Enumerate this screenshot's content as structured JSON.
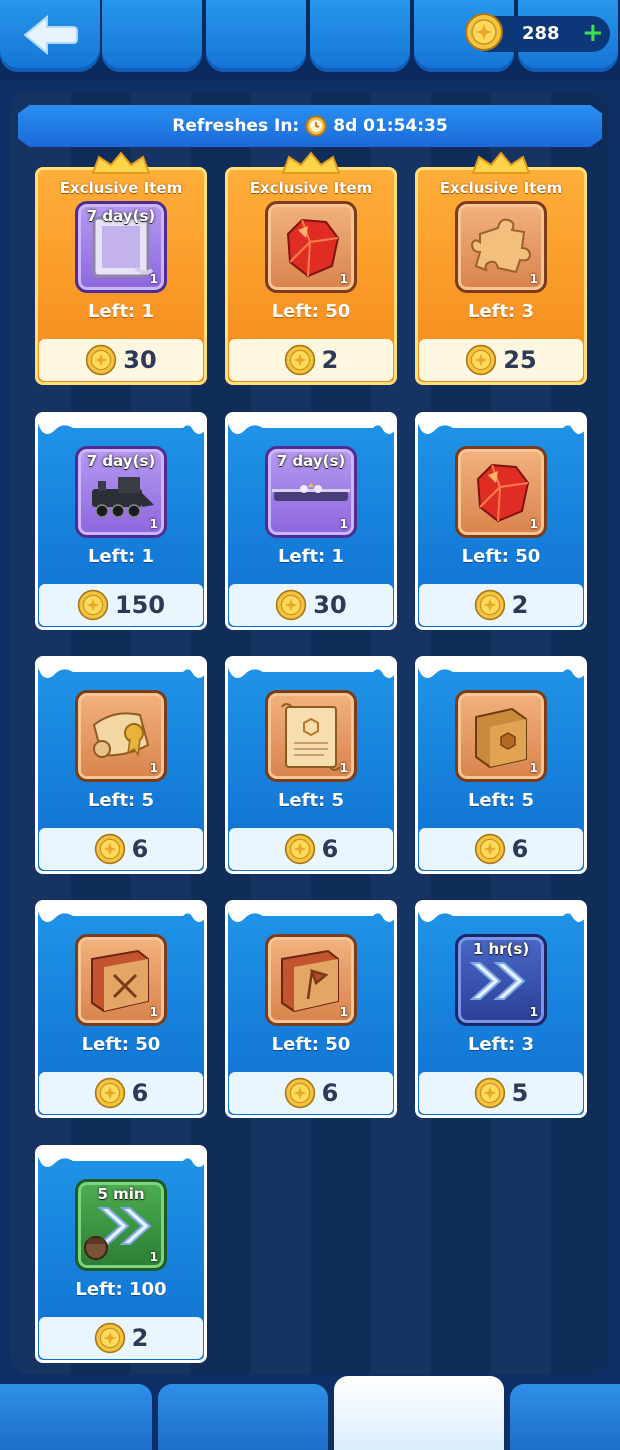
{
  "header": {
    "currency_amount": "288",
    "currency_plus": "+"
  },
  "banner": {
    "label": "Refreshes In:",
    "countdown": "8d 01:54:35"
  },
  "colors": {
    "accent_blue": "#1f95e8",
    "exclusive_orange": "#f5891a",
    "coin_gold": "#f4c53a",
    "plus_green": "#3fe04a"
  },
  "shop": {
    "items": [
      {
        "kind": "exclusive",
        "badge": "Exclusive Item",
        "icon": "frame-icon",
        "frame": "purple",
        "duration": "7 day(s)",
        "qty": "1",
        "left": "Left: 1",
        "price": "30"
      },
      {
        "kind": "exclusive",
        "badge": "Exclusive Item",
        "icon": "ruby-gem-icon",
        "frame": "orange",
        "duration": "",
        "qty": "1",
        "left": "Left: 50",
        "price": "2"
      },
      {
        "kind": "exclusive",
        "badge": "Exclusive Item",
        "icon": "puzzle-piece-icon",
        "frame": "orange",
        "duration": "",
        "qty": "1",
        "left": "Left: 3",
        "price": "25"
      },
      {
        "kind": "normal",
        "badge": "",
        "icon": "train-icon",
        "frame": "purple",
        "duration": "7 day(s)",
        "qty": "1",
        "left": "Left: 1",
        "price": "150"
      },
      {
        "kind": "normal",
        "badge": "",
        "icon": "nameplate-icon",
        "frame": "purple",
        "duration": "7 day(s)",
        "qty": "1",
        "left": "Left: 1",
        "price": "30"
      },
      {
        "kind": "normal",
        "badge": "",
        "icon": "ruby-gem-icon",
        "frame": "orange",
        "duration": "",
        "qty": "1",
        "left": "Left: 50",
        "price": "2"
      },
      {
        "kind": "normal",
        "badge": "",
        "icon": "scroll-seal-icon",
        "frame": "orange",
        "duration": "",
        "qty": "1",
        "left": "Left: 5",
        "price": "6"
      },
      {
        "kind": "normal",
        "badge": "",
        "icon": "parchment-icon",
        "frame": "orange",
        "duration": "",
        "qty": "1",
        "left": "Left: 5",
        "price": "6"
      },
      {
        "kind": "normal",
        "badge": "",
        "icon": "hex-book-icon",
        "frame": "orange",
        "duration": "",
        "qty": "1",
        "left": "Left: 5",
        "price": "6"
      },
      {
        "kind": "normal",
        "badge": "",
        "icon": "swords-book-icon",
        "frame": "orange",
        "duration": "",
        "qty": "1",
        "left": "Left: 50",
        "price": "6"
      },
      {
        "kind": "normal",
        "badge": "",
        "icon": "flag-book-icon",
        "frame": "orange",
        "duration": "",
        "qty": "1",
        "left": "Left: 50",
        "price": "6"
      },
      {
        "kind": "normal",
        "badge": "",
        "icon": "speedup-icon",
        "frame": "navy",
        "duration": "1 hr(s)",
        "qty": "1",
        "left": "Left: 3",
        "price": "5"
      },
      {
        "kind": "normal",
        "badge": "",
        "icon": "hero-speedup-icon",
        "frame": "green",
        "duration": "5 min",
        "qty": "1",
        "left": "Left: 100",
        "price": "2"
      }
    ]
  }
}
